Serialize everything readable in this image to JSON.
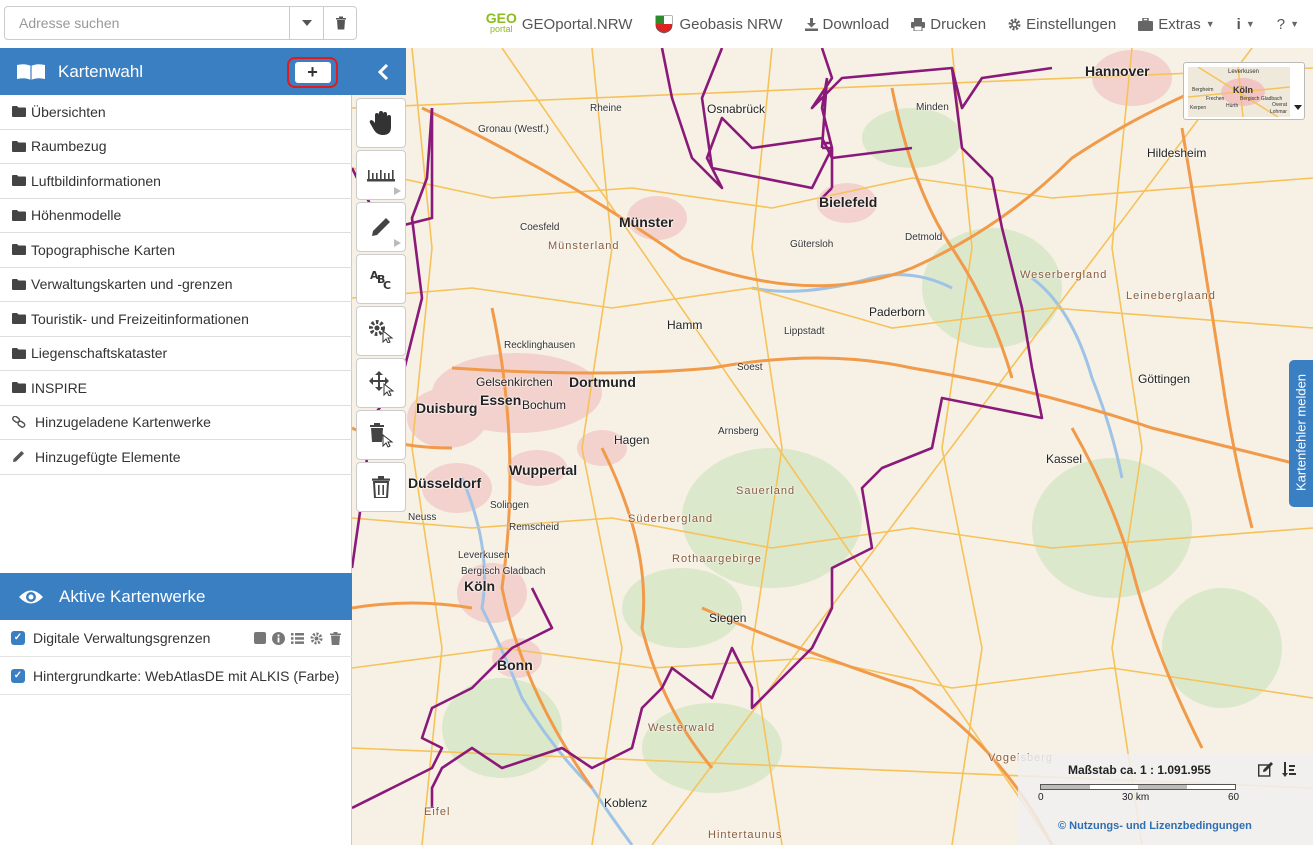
{
  "search": {
    "placeholder": "Adresse suchen"
  },
  "nav": {
    "geoportal_logo_top": "GEO",
    "geoportal_logo_bottom": "portal",
    "geoportal": "GEOportal.NRW",
    "geobasis": "Geobasis NRW",
    "download": "Download",
    "print": "Drucken",
    "settings": "Einstellungen",
    "extras": "Extras",
    "info": "i",
    "help": "?"
  },
  "panel": {
    "title": "Kartenwahl",
    "add_label": "+",
    "items": [
      {
        "label": "Übersichten",
        "icon": "folder-icon"
      },
      {
        "label": "Raumbezug",
        "icon": "folder-icon"
      },
      {
        "label": "Luftbildinformationen",
        "icon": "folder-icon"
      },
      {
        "label": "Höhenmodelle",
        "icon": "folder-icon"
      },
      {
        "label": "Topographische Karten",
        "icon": "folder-icon"
      },
      {
        "label": "Verwaltungskarten und -grenzen",
        "icon": "folder-icon"
      },
      {
        "label": "Touristik- und Freizeitinformationen",
        "icon": "folder-icon"
      },
      {
        "label": "Liegenschaftskataster",
        "icon": "folder-icon"
      },
      {
        "label": "INSPIRE",
        "icon": "folder-icon"
      },
      {
        "label": "Hinzugeladene Kartenwerke",
        "icon": "link-icon"
      },
      {
        "label": "Hinzugefügte Elemente",
        "icon": "pencil-icon"
      }
    ]
  },
  "active": {
    "title": "Aktive Kartenwerke",
    "layers": [
      {
        "label": "Digitale Verwaltungsgrenzen",
        "checked": true
      },
      {
        "label": "Hintergrundkarte: WebAtlasDE mit ALKIS (Farbe)",
        "checked": true
      }
    ]
  },
  "tools": [
    "pan-hand-icon",
    "measure-icon",
    "draw-pencil-icon",
    "text-abc-icon",
    "edit-settings-icon",
    "move-icon",
    "delete-select-icon",
    "trash-icon"
  ],
  "map": {
    "labels": [
      {
        "t": "Hannover",
        "c": "big"
      },
      {
        "t": "Osnabrück",
        "c": "mid"
      },
      {
        "t": "Bielefeld",
        "c": "big"
      },
      {
        "t": "Münster",
        "c": "big"
      },
      {
        "t": "Dortmund",
        "c": "big"
      },
      {
        "t": "Essen",
        "c": "big"
      },
      {
        "t": "Duisburg",
        "c": "big"
      },
      {
        "t": "Düsseldorf",
        "c": "big"
      },
      {
        "t": "Wuppertal",
        "c": "big"
      },
      {
        "t": "Köln",
        "c": "big"
      },
      {
        "t": "Bonn",
        "c": "big"
      },
      {
        "t": "Paderborn",
        "c": "mid"
      },
      {
        "t": "Kassel",
        "c": "mid"
      },
      {
        "t": "Siegen",
        "c": "mid"
      },
      {
        "t": "Hagen",
        "c": "mid"
      },
      {
        "t": "Hamm",
        "c": "mid"
      },
      {
        "t": "Göttingen",
        "c": "mid"
      },
      {
        "t": "Hildesheim",
        "c": "mid"
      },
      {
        "t": "Koblenz",
        "c": "mid"
      },
      {
        "t": "Gelsenkirchen",
        "c": "mid"
      },
      {
        "t": "Bochum",
        "c": "mid"
      },
      {
        "t": "Leverkusen",
        "c": ""
      },
      {
        "t": "Solingen",
        "c": ""
      },
      {
        "t": "Remscheid",
        "c": ""
      },
      {
        "t": "Neuss",
        "c": ""
      },
      {
        "t": "Gütersloh",
        "c": ""
      },
      {
        "t": "Detmold",
        "c": ""
      },
      {
        "t": "Minden",
        "c": ""
      },
      {
        "t": "Lippstadt",
        "c": ""
      },
      {
        "t": "Soest",
        "c": ""
      },
      {
        "t": "Arnsberg",
        "c": ""
      },
      {
        "t": "Recklinghausen",
        "c": ""
      },
      {
        "t": "Rheine",
        "c": ""
      },
      {
        "t": "Gronau (Westf.)",
        "c": ""
      },
      {
        "t": "Coesfeld",
        "c": ""
      },
      {
        "t": "Bergisch Gladbach",
        "c": ""
      },
      {
        "t": "Sauerland",
        "c": "region"
      },
      {
        "t": "Rothaargebirge",
        "c": "region"
      },
      {
        "t": "Westerwald",
        "c": "region"
      },
      {
        "t": "Münsterland",
        "c": "region"
      },
      {
        "t": "Weserbergland",
        "c": "region"
      },
      {
        "t": "Leineberglaand",
        "c": "region"
      },
      {
        "t": "Süderbergland",
        "c": "region"
      },
      {
        "t": "Vogelsberg",
        "c": "region"
      },
      {
        "t": "Eifel",
        "c": "region"
      },
      {
        "t": "Hintertaunus",
        "c": "region"
      }
    ]
  },
  "overview": {
    "labels": [
      "Leverkusen",
      "Köln",
      "Bergisch Gladbach",
      "Frechen",
      "Hürth",
      "Kerpen",
      "Bergheim",
      "Overat",
      "Lohmar"
    ]
  },
  "report_tab": "Kartenfehler melden",
  "scale": {
    "title": "Maßstab ca. 1 : 1.091.955",
    "ticks": [
      "0",
      "30 km",
      "60"
    ],
    "license": "© Nutzungs- und Lizenzbedingungen"
  },
  "colors": {
    "accent": "#3a7fc1",
    "highlight_border": "#e01b1b",
    "boundary": "#8a1a7a",
    "autobahn": "#f19a4a",
    "road": "#f6c25a"
  }
}
